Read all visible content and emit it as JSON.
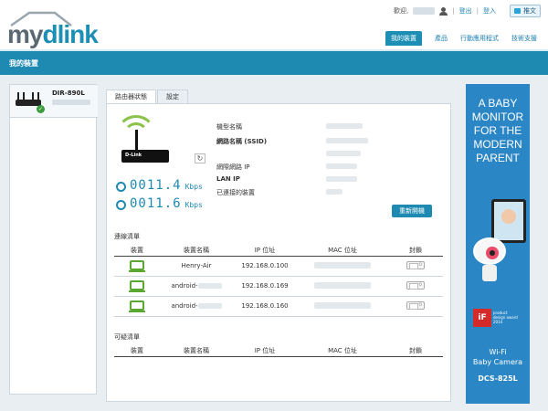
{
  "header": {
    "logo_my": "my",
    "logo_dlink": "dlink",
    "welcome": "歡迎,",
    "logout": "登出",
    "login": "登入",
    "tweet": "推文"
  },
  "nav": {
    "items": [
      "我的裝置",
      "產品",
      "行動應用程式",
      "技術支援"
    ],
    "active": "我的裝置"
  },
  "page_title": "我的裝置",
  "device": {
    "name": "DIR-890L"
  },
  "tabs": [
    "路由器狀態",
    "設定"
  ],
  "speeds": [
    {
      "value": "0011.4",
      "unit": "Kbps"
    },
    {
      "value": "0011.6",
      "unit": "Kbps"
    }
  ],
  "router_label": "D-Link",
  "info_labels": {
    "model": "機型名稱",
    "ssid": "網路名稱 (SSID)",
    "wan_ip": "網際網路 IP",
    "lan_ip": "LAN IP",
    "connected": "已連接的裝置"
  },
  "reboot_button": "重新開機",
  "connection_list": {
    "title": "連線清單",
    "columns": [
      "裝置",
      "裝置名稱",
      "IP 位址",
      "MAC 位址",
      "封鎖"
    ],
    "rows": [
      {
        "name": "Henry-Air",
        "ip": "192.168.0.100"
      },
      {
        "name": "android-",
        "ip": "192.168.0.169"
      },
      {
        "name": "android-",
        "ip": "192.168.0.160"
      }
    ]
  },
  "suspect_list": {
    "title": "可疑清單",
    "columns": [
      "裝置",
      "裝置名稱",
      "IP 位址",
      "MAC 位址",
      "封鎖"
    ]
  },
  "ad": {
    "headline": [
      "A BABY",
      "MONITOR",
      "FOR THE",
      "MODERN",
      "PARENT"
    ],
    "badge": "iF",
    "badge_text": [
      "product",
      "design award",
      "2014"
    ],
    "subtitle": [
      "Wi-Fi",
      "Baby Camera"
    ],
    "model": "DCS-825L"
  },
  "colors": {
    "brand_blue": "#1e8ab2",
    "accent_green": "#8bc34a"
  }
}
